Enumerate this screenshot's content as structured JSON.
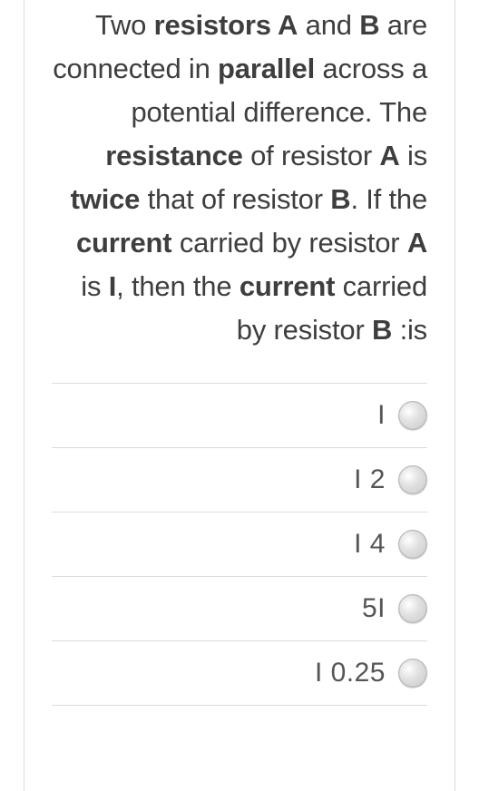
{
  "question_html": "Two <b>resistors A</b> and <b>B</b> are connected in <b>parallel</b> across a potential difference. The <b>resistance</b> of resistor <b>A</b> is <b>twice</b> that of resistor <b>B</b>. If the <b>current</b> carried by resistor <b>A</b> is <b>I</b>, then the <b>current</b> carried by resistor <b>B</b> :is",
  "options": [
    {
      "label": "I"
    },
    {
      "label": "I 2"
    },
    {
      "label": "I 4"
    },
    {
      "label": "5I"
    },
    {
      "label": "I 0.25"
    }
  ]
}
